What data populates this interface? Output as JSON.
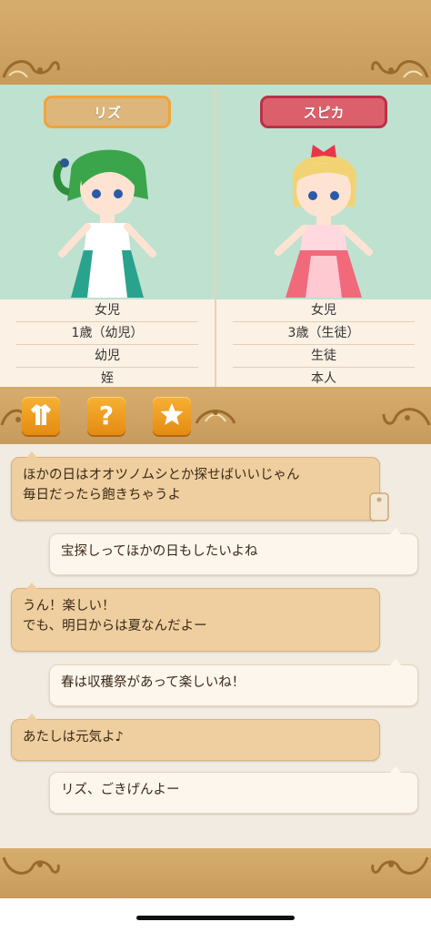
{
  "characters": [
    {
      "name": "リズ",
      "rows": [
        "女児",
        "1歳（幼児）",
        "幼児",
        "姪"
      ]
    },
    {
      "name": "スピカ",
      "rows": [
        "女児",
        "3歳（生徒）",
        "生徒",
        "本人"
      ]
    }
  ],
  "tabs": [
    {
      "icon": "outfit-icon"
    },
    {
      "icon": "question-icon",
      "glyph": "?"
    },
    {
      "icon": "star-icon"
    }
  ],
  "messages": [
    {
      "side": "left",
      "lines": [
        "ほかの日はオオツノムシとか探せばいいじゃん",
        "毎日だったら飽きちゃうよ"
      ]
    },
    {
      "side": "right",
      "lines": [
        "宝探しってほかの日もしたいよね"
      ]
    },
    {
      "side": "left",
      "lines": [
        "うん！楽しい！",
        "でも、明日からは夏なんだよー"
      ]
    },
    {
      "side": "right",
      "lines": [
        "春は収穫祭があって楽しいね！"
      ]
    },
    {
      "side": "left",
      "lines": [
        "あたしは元気よ♪"
      ]
    },
    {
      "side": "right",
      "lines": [
        "リズ、ごきげんよー"
      ]
    }
  ],
  "colors": {
    "wood": "#d7ad6e",
    "portrait_bg": "#bfe1d0",
    "riz_tag": "#ddb67b",
    "spica_tag": "#dc606c",
    "tab_orange": "#f0a025",
    "bubble_left": "#efcf9f",
    "bubble_right": "#fdf6ec"
  }
}
